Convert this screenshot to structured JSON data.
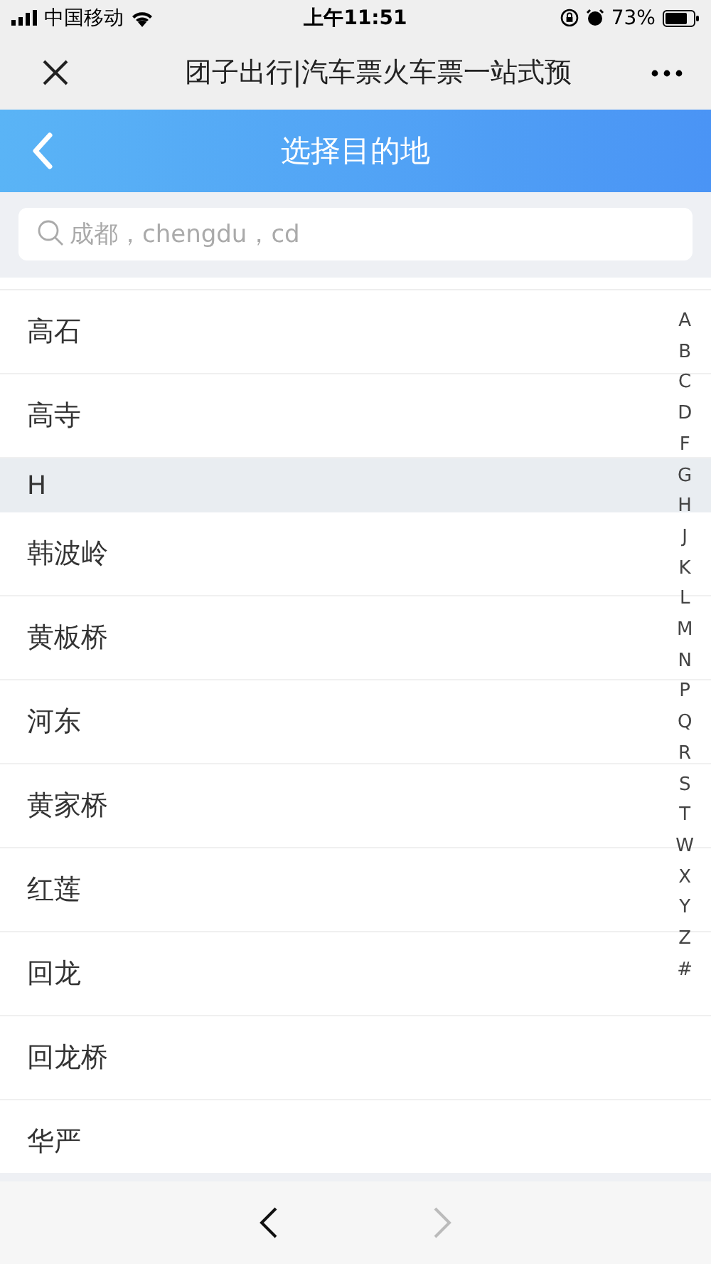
{
  "status_bar": {
    "carrier": "中国移动",
    "time": "上午11:51",
    "battery": "73%"
  },
  "browser_bar": {
    "title": "团子出行|汽车票火车票一站式预"
  },
  "header": {
    "title": "选择目的地"
  },
  "search": {
    "placeholder": "成都，chengdu，cd"
  },
  "list": [
    {
      "kind": "item",
      "label": "高石"
    },
    {
      "kind": "item",
      "label": "高寺"
    },
    {
      "kind": "header",
      "label": "H"
    },
    {
      "kind": "item",
      "label": "韩波岭"
    },
    {
      "kind": "item",
      "label": "黄板桥"
    },
    {
      "kind": "item",
      "label": "河东"
    },
    {
      "kind": "item",
      "label": "黄家桥"
    },
    {
      "kind": "item",
      "label": "红莲"
    },
    {
      "kind": "item",
      "label": "回龙"
    },
    {
      "kind": "item",
      "label": "回龙桥"
    },
    {
      "kind": "item",
      "label": "华严"
    }
  ],
  "index": [
    "A",
    "B",
    "C",
    "D",
    "F",
    "G",
    "H",
    "J",
    "K",
    "L",
    "M",
    "N",
    "P",
    "Q",
    "R",
    "S",
    "T",
    "W",
    "X",
    "Y",
    "Z",
    "#"
  ],
  "nav": {
    "back_disabled": false,
    "forward_disabled": true
  }
}
